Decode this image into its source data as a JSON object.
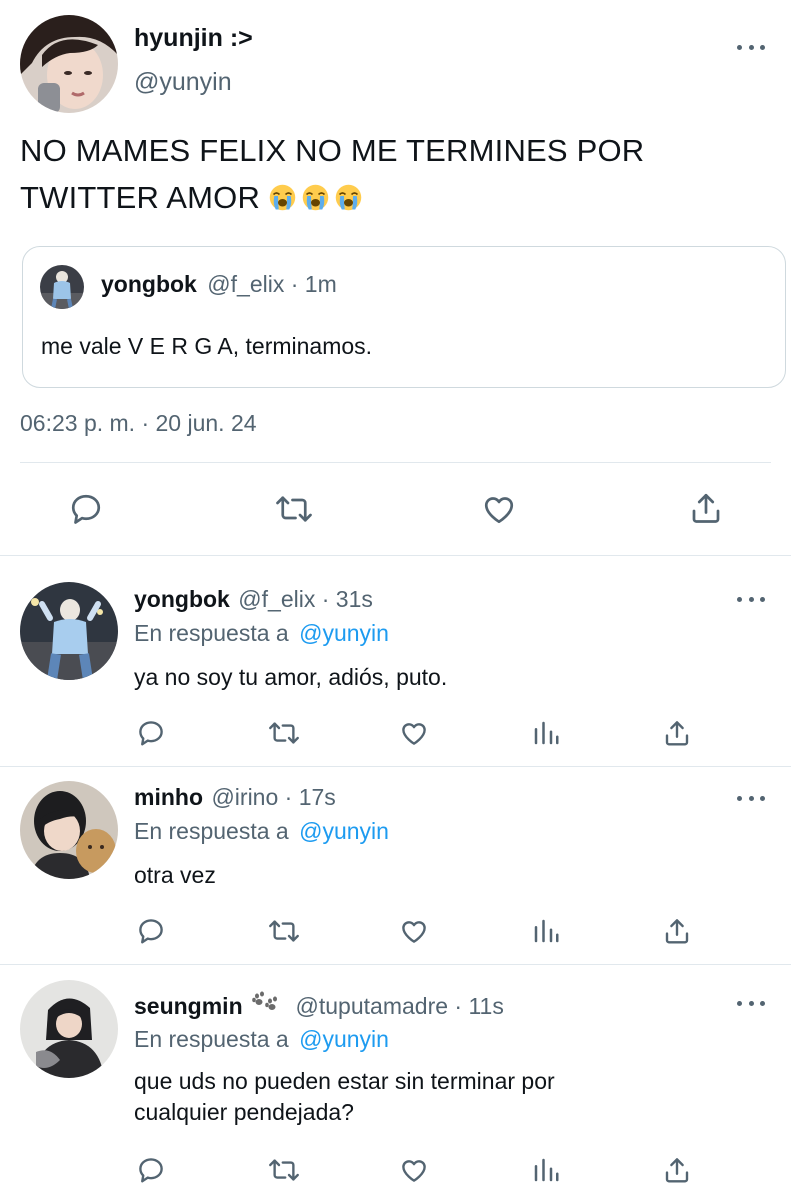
{
  "main_tweet": {
    "author_name": "hyunjin :>",
    "author_handle": "@yunyin",
    "text": "NO MAMES FELIX NO ME TERMINES POR TWITTER AMOR",
    "emoji_count": 3,
    "emoji": "loudly-crying-face",
    "timestamp": "06:23 p. m. · 20 jun. 24",
    "quoted": {
      "author_name": "yongbok",
      "meta": "@f_elix · 1m",
      "text": "me vale V E R G A, terminamos."
    },
    "actions": [
      "reply-icon",
      "retweet-icon",
      "like-icon",
      "share-icon"
    ]
  },
  "replies": [
    {
      "author_name": "yongbok",
      "meta": "@f_elix · 31s",
      "reply_to_label": "En respuesta a",
      "reply_to_handle": "@yunyin",
      "text_lines": [
        "ya no soy tu amor, adiós, puto."
      ]
    },
    {
      "author_name": "minho",
      "meta": "@irino · 17s",
      "reply_to_label": "En respuesta a",
      "reply_to_handle": "@yunyin",
      "text_lines": [
        "otra vez"
      ]
    },
    {
      "author_name": "seungmin",
      "name_icon": "paw-prints-icon",
      "meta": "@tuputamadre · 11s",
      "reply_to_label": "En respuesta a",
      "reply_to_handle": "@yunyin",
      "text_lines": [
        "que uds no pueden estar sin terminar por",
        "cualquier pendejada?"
      ]
    }
  ],
  "colors": {
    "text": "#0f1419",
    "muted": "#536471",
    "link": "#1d9bf0",
    "border": "#cfd9de",
    "divider": "#e1e8ed"
  }
}
